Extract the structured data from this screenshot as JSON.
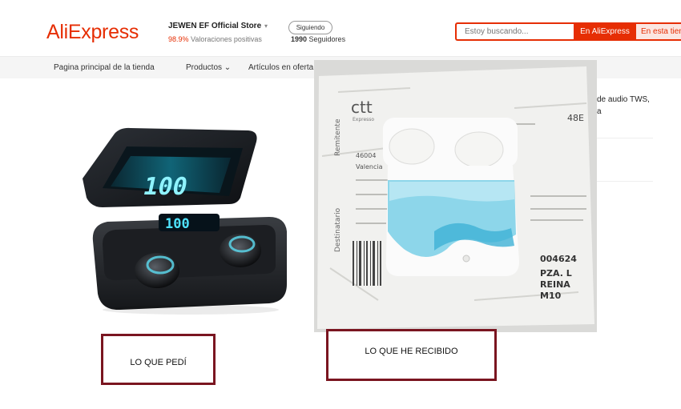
{
  "header": {
    "logo": "AliExpress",
    "store_name": "JEWEN EF Official Store",
    "store_caret": "▾",
    "rating_value": "98.9%",
    "rating_text": " Valoraciones positivas",
    "follow_label": "Siguiendo",
    "followers_count": "1990",
    "followers_text": " Seguidores",
    "search_placeholder": "Estoy buscando...",
    "search_aliexpress_label": "En AliExpress",
    "search_store_label": "En esta tienda"
  },
  "nav": {
    "items": [
      {
        "label": "Pagina principal de la tienda"
      },
      {
        "label": "Productos ⌄"
      },
      {
        "label": "Artículos en oferta"
      }
    ]
  },
  "product": {
    "title_fragment_1": "de audio TWS,",
    "title_fragment_2": "a"
  },
  "annotations": {
    "ordered_label": "LO QUE PEDÍ",
    "received_label": "LO QUE HE RECIBIDO"
  },
  "photo": {
    "brand": "ctt",
    "brand_sub": "Expresso",
    "sender_side": "Remitente",
    "dest_side": "Destinatario",
    "code": "48E",
    "city": "Valencia",
    "postal_fragment": "46004",
    "label_lines": [
      "004624",
      "PZA. L",
      "REINA",
      "M10"
    ]
  },
  "colors": {
    "brand_red": "#e62e04",
    "callout_border": "#7a1520"
  }
}
